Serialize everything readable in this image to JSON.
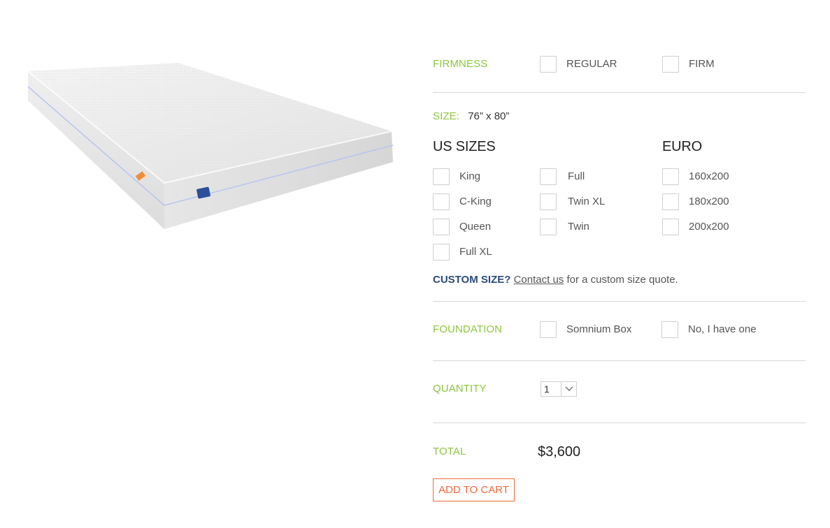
{
  "firmness": {
    "label": "FIRMNESS",
    "options": [
      "REGULAR",
      "FIRM"
    ]
  },
  "size": {
    "label": "SIZE:",
    "value": "76” x 80”",
    "us_heading": "US SIZES",
    "euro_heading": "EURO",
    "us_col1": [
      "King",
      "C-King",
      "Queen",
      "Full XL"
    ],
    "us_col2": [
      "Full",
      "Twin XL",
      "Twin"
    ],
    "euro": [
      "160x200",
      "180x200",
      "200x200"
    ]
  },
  "custom": {
    "strong": "CUSTOM SIZE?",
    "link": "Contact us",
    "rest": " for a custom size quote."
  },
  "foundation": {
    "label": "FOUNDATION",
    "options": [
      "Somnium Box",
      "No, I have one"
    ]
  },
  "quantity": {
    "label": "QUANTITY",
    "value": "1"
  },
  "total": {
    "label": "TOTAL",
    "value": "$3,600"
  },
  "cart": {
    "button_label": "ADD TO CART"
  },
  "colors": {
    "label_green": "#8cc63f",
    "link_blue": "#2a4b7a",
    "cart_orange": "#f06b3c"
  },
  "icons": {
    "dropdown": "chevron-down-icon"
  }
}
